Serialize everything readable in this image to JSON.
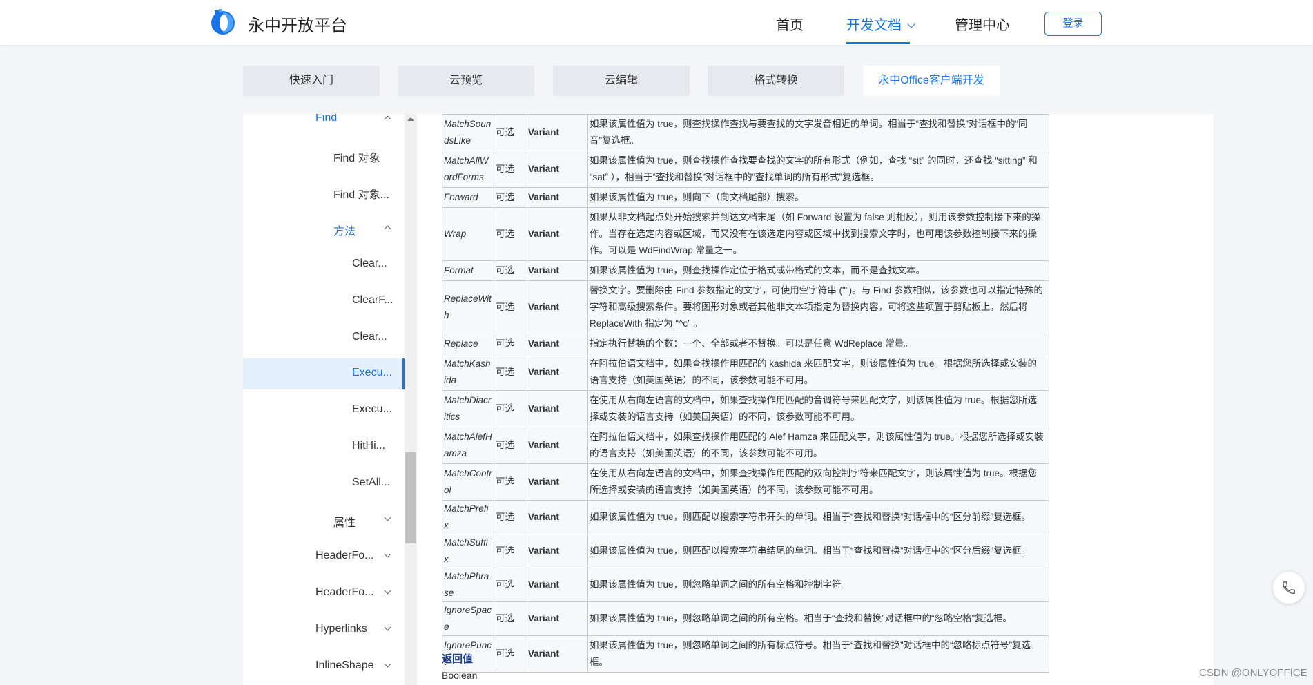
{
  "header": {
    "logo_text": "永中开放平台",
    "nav": [
      "首页",
      "开发文档",
      "管理中心"
    ],
    "login": "登录",
    "accent": "#1a73e8"
  },
  "tabs": [
    "快速入门",
    "云预览",
    "云编辑",
    "格式转换",
    "永中Office客户端开发"
  ],
  "sidebar": {
    "items": [
      "Find",
      "Find 对象",
      "Find 对象...",
      "方法",
      "Clear...",
      "ClearF...",
      "Clear...",
      "Execu...",
      "Execu...",
      "HitHi...",
      "SetAll...",
      "属性",
      "HeaderFo...",
      "HeaderFo...",
      "Hyperlinks",
      "InlineShape"
    ]
  },
  "table": {
    "rows": [
      {
        "name": "MatchSoundsLike",
        "opt": "可选",
        "type": "Variant",
        "desc": "如果该属性值为 true，则查找操作查找与要查找的文字发音相近的单词。相当于“查找和替换”对话框中的“同音”复选框。"
      },
      {
        "name": "MatchAllWordForms",
        "opt": "可选",
        "type": "Variant",
        "desc": "如果该属性值为 true，则查找操作查找要查找的文字的所有形式（例如，查找 “sit” 的同时，还查找 “sitting” 和 “sat” ），相当于“查找和替换”对话框中的“查找单词的所有形式”复选框。"
      },
      {
        "name": "Forward",
        "opt": "可选",
        "type": "Variant",
        "desc": "如果该属性值为 true，则向下（向文档尾部）搜索。"
      },
      {
        "name": "Wrap",
        "opt": "可选",
        "type": "Variant",
        "desc": "如果从非文档起点处开始搜索并到达文档末尾（如 Forward 设置为 false 则相反），则用该参数控制接下来的操作。当存在选定内容或区域，而又没有在该选定内容或区域中找到搜索文字时，也可用该参数控制接下来的操作。可以是 WdFindWrap 常量之一。"
      },
      {
        "name": "Format",
        "opt": "可选",
        "type": "Variant",
        "desc": "如果该属性值为 true，则查找操作定位于格式或带格式的文本，而不是查找文本。"
      },
      {
        "name": "ReplaceWith",
        "opt": "可选",
        "type": "Variant",
        "desc": "替换文字。要删除由 Find 参数指定的文字，可使用空字符串 (\"\")。与 Find 参数相似，该参数也可以指定特殊的字符和高级搜索条件。要将图形对象或者其他非文本项指定为替换内容，可将这些项置于剪贴板上，然后将 ReplaceWith 指定为 “^c” 。"
      },
      {
        "name": "Replace",
        "opt": "可选",
        "type": "Variant",
        "desc": "指定执行替换的个数：一个、全部或者不替换。可以是任意 WdReplace 常量。"
      },
      {
        "name": "MatchKashida",
        "opt": "可选",
        "type": "Variant",
        "desc": "在阿拉伯语文档中，如果查找操作用匹配的 kashida 来匹配文字，则该属性值为 true。根据您所选择或安装的语言支持（如美国英语）的不同，该参数可能不可用。"
      },
      {
        "name": "MatchDiacritics",
        "opt": "可选",
        "type": "Variant",
        "desc": "在使用从右向左语言的文档中，如果查找操作用匹配的音调符号来匹配文字，则该属性值为 true。根据您所选择或安装的语言支持（如美国英语）的不同，该参数可能不可用。"
      },
      {
        "name": "MatchAlefHamza",
        "opt": "可选",
        "type": "Variant",
        "desc": "在阿拉伯语文档中，如果查找操作用匹配的 Alef Hamza 来匹配文字，则该属性值为 true。根据您所选择或安装的语言支持（如美国英语）的不同，该参数可能不可用。"
      },
      {
        "name": "MatchControl",
        "opt": "可选",
        "type": "Variant",
        "desc": "在使用从右向左语言的文档中，如果查找操作用匹配的双向控制字符来匹配文字，则该属性值为 true。根据您所选择或安装的语言支持（如美国英语）的不同，该参数可能不可用。"
      },
      {
        "name": "MatchPrefix",
        "opt": "可选",
        "type": "Variant",
        "desc": "如果该属性值为 true，则匹配以搜索字符串开头的单词。相当于“查找和替换”对话框中的“区分前缀”复选框。"
      },
      {
        "name": "MatchSuffix",
        "opt": "可选",
        "type": "Variant",
        "desc": "如果该属性值为 true，则匹配以搜索字符串结尾的单词。相当于“查找和替换”对话框中的“区分后缀”复选框。"
      },
      {
        "name": "MatchPhrase",
        "opt": "可选",
        "type": "Variant",
        "desc": "如果该属性值为 true，则忽略单词之间的所有空格和控制字符。"
      },
      {
        "name": "IgnoreSpace",
        "opt": "可选",
        "type": "Variant",
        "desc": "如果该属性值为 true，则忽略单词之间的所有空格。相当于“查找和替换”对话框中的“忽略空格”复选框。"
      },
      {
        "name": "IgnorePunct",
        "opt": "可选",
        "type": "Variant",
        "desc": "如果该属性值为 true，则忽略单词之间的所有标点符号。相当于“查找和替换”对话框中的“忽略标点符号”复选框。"
      }
    ]
  },
  "return": {
    "title": "返回值",
    "value": "Boolean"
  },
  "watermark": "CSDN @ONLYOFFICE"
}
